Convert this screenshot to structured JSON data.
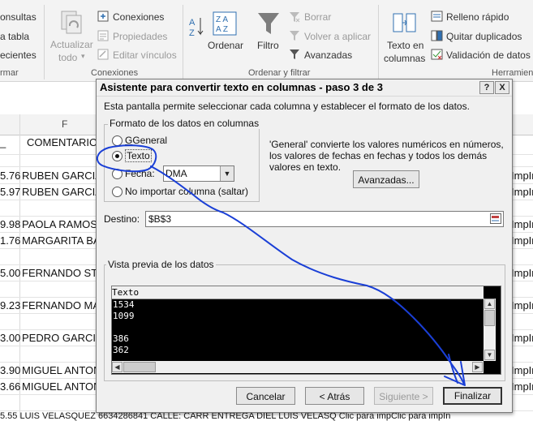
{
  "ribbon": {
    "left_items": [
      "onsultas",
      "a tabla",
      "ecientes"
    ],
    "left_group": "rmar",
    "actualizar_label": "Actualizar",
    "actualizar_sub": "todo",
    "conexiones_items": [
      "Conexiones",
      "Propiedades",
      "Editar vínculos"
    ],
    "conexiones_group": "Conexiones",
    "ordenar_label": "Ordenar",
    "filtro_label": "Filtro",
    "filter_items": [
      "Borrar",
      "Volver a aplicar",
      "Avanzadas"
    ],
    "ordenar_group": "Ordenar y filtrar",
    "texto_columnas_label": [
      "Texto en",
      "columnas"
    ],
    "data_tools": [
      "Relleno rápido",
      "Quitar duplicados",
      "Validación de datos"
    ],
    "herramientas_group": "Herramien"
  },
  "sheet": {
    "column_letter": "F",
    "header_cells": [
      "_",
      "COMENTARIO"
    ],
    "rows": [
      {
        "num": "5.76",
        "name": "RUBEN GARCIA",
        "right": "ImpIn"
      },
      {
        "num": "5.97",
        "name": "RUBEN GARCIA",
        "right": "ImpIn"
      },
      {
        "num": "9.98",
        "name": "PAOLA RAMOS",
        "right": "ImpIn"
      },
      {
        "num": "1.76",
        "name": "MARGARITA BA",
        "right": "ImpIn"
      },
      {
        "num": "5.00",
        "name": "FERNANDO STO",
        "right": "ImpIn"
      },
      {
        "num": "9.23",
        "name": "FERNANDO MA",
        "right": "ImpIn"
      },
      {
        "num": "3.00",
        "name": "PEDRO GARCIA",
        "right": "ImpIn"
      },
      {
        "num": "3.90",
        "name": "MIGUEL ANTON",
        "right": "ImpIn"
      },
      {
        "num": "3.66",
        "name": "MIGUEL ANTON",
        "right": "ImpIn"
      }
    ],
    "bottom_row": "5.55 LUIS VELASQUEZ          6634286841  CALLE: CARR ENTREGA DIEL LUIS VELASQ Clic para impClic para impIn"
  },
  "dialog": {
    "title": "Asistente para convertir texto en columnas - paso 3 de 3",
    "help_btn": "?",
    "close_btn": "X",
    "intro": "Esta pantalla permite seleccionar cada columna y establecer el formato de los datos.",
    "format_group": "Formato de los datos en columnas",
    "options": {
      "general": "General",
      "texto": "Texto",
      "fecha": "Fecha:",
      "no_importar": "No importar columna (saltar)"
    },
    "selected_option": "Texto",
    "date_format": "DMA",
    "general_desc": [
      "'General' convierte los valores numéricos en números,",
      "los valores de fechas en fechas y todos los demás",
      "valores en texto."
    ],
    "avanzadas_btn": "Avanzadas...",
    "destino_label": "Destino:",
    "destino_value": "$B$3",
    "preview_label": "Vista previa de los datos",
    "preview_header": "Texto",
    "preview_rows": [
      "1534",
      "1099",
      "",
      "386",
      "362"
    ],
    "buttons": {
      "cancel": "Cancelar",
      "back": "< Atrás",
      "next": "Siguiente >",
      "finish": "Finalizar"
    }
  },
  "colors": {
    "annotation_ink": "#1a3fd6",
    "dialog_bg": "#f0f0f0",
    "preview_bg": "#000000"
  }
}
